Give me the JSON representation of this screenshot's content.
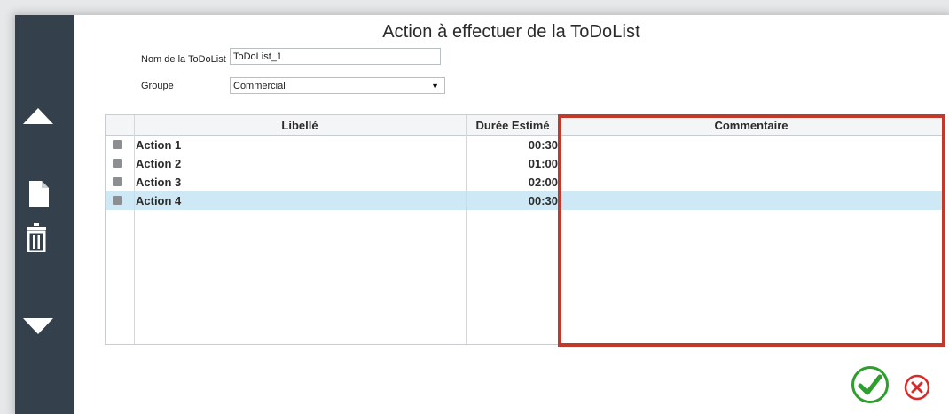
{
  "dialog": {
    "title": "Action à effectuer de la ToDoList",
    "name_label": "Nom de la ToDoList",
    "name_value": "ToDoList_1",
    "group_label": "Groupe",
    "group_value": "Commercial"
  },
  "sidebar": {
    "icons": [
      "arrow-up-icon",
      "new-file-icon",
      "trash-icon",
      "arrow-down-icon"
    ]
  },
  "table": {
    "headers": {
      "libelle": "Libellé",
      "duree": "Durée Estimé",
      "commentaire": "Commentaire"
    },
    "rows": [
      {
        "libelle": "Action 1",
        "duree": "00:30",
        "commentaire": ""
      },
      {
        "libelle": "Action 2",
        "duree": "01:00",
        "commentaire": ""
      },
      {
        "libelle": "Action 3",
        "duree": "02:00",
        "commentaire": ""
      },
      {
        "libelle": "Action 4",
        "duree": "00:30",
        "commentaire": "",
        "selected": true
      }
    ]
  },
  "actions": {
    "ok_icon": "check-circle-icon",
    "cancel_icon": "close-circle-icon"
  },
  "colors": {
    "sidebar": "#34404c",
    "selected_row": "#cfe8f6",
    "highlight_border": "#c0392b",
    "ok_green": "#2e9e2e",
    "cancel_red": "#d62b2b"
  }
}
